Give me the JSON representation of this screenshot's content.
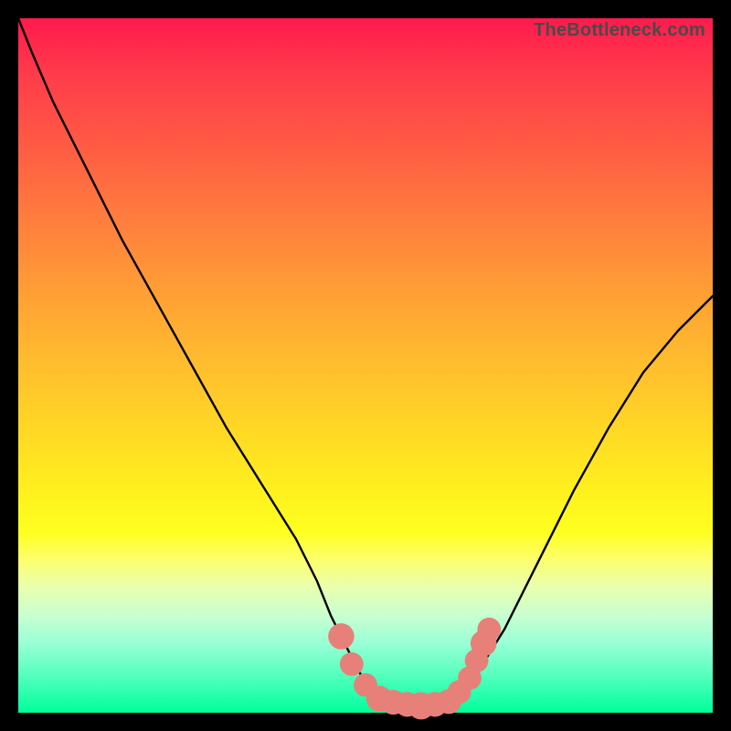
{
  "watermark": "TheBottleneck.com",
  "colors": {
    "frame": "#000000",
    "curve_stroke": "#000000",
    "marker_fill": "#e78079",
    "marker_stroke": "#e78079"
  },
  "chart_data": {
    "type": "line",
    "title": "",
    "xlabel": "",
    "ylabel": "",
    "xlim": [
      0,
      100
    ],
    "ylim": [
      0,
      100
    ],
    "grid": false,
    "legend": false,
    "series": [
      {
        "name": "bottleneck-curve",
        "x": [
          0,
          2,
          5,
          10,
          15,
          20,
          25,
          30,
          35,
          40,
          43,
          45,
          47,
          49,
          51,
          53,
          55,
          57,
          58,
          60,
          62,
          65,
          70,
          75,
          80,
          85,
          90,
          95,
          100
        ],
        "y": [
          100,
          95,
          88,
          78,
          68,
          59,
          50,
          41,
          33,
          25,
          19,
          14,
          10,
          6,
          3,
          2,
          1.5,
          1.2,
          1,
          1.2,
          1.6,
          4,
          12,
          22,
          32,
          41,
          49,
          55,
          60
        ]
      }
    ],
    "markers": [
      {
        "x": 46.5,
        "y": 11,
        "r": 1.5
      },
      {
        "x": 48.0,
        "y": 7,
        "r": 1.3
      },
      {
        "x": 50.0,
        "y": 4,
        "r": 1.3
      },
      {
        "x": 52.0,
        "y": 2,
        "r": 1.5
      },
      {
        "x": 54.0,
        "y": 1.5,
        "r": 1.4
      },
      {
        "x": 56.0,
        "y": 1.2,
        "r": 1.4
      },
      {
        "x": 58.0,
        "y": 1.0,
        "r": 1.6
      },
      {
        "x": 60.0,
        "y": 1.2,
        "r": 1.4
      },
      {
        "x": 62.0,
        "y": 1.6,
        "r": 1.4
      },
      {
        "x": 63.5,
        "y": 3,
        "r": 1.3
      },
      {
        "x": 65.0,
        "y": 5,
        "r": 1.3
      },
      {
        "x": 66.0,
        "y": 7.5,
        "r": 1.3
      },
      {
        "x": 67.0,
        "y": 10,
        "r": 1.5
      },
      {
        "x": 67.8,
        "y": 12,
        "r": 1.3
      }
    ]
  }
}
